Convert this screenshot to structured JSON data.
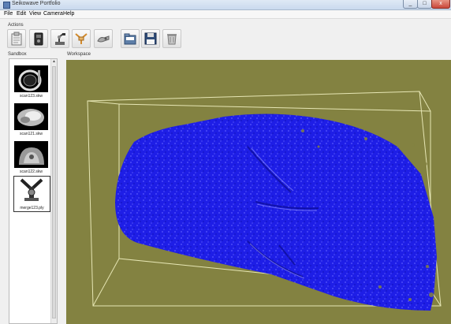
{
  "window": {
    "title": "Seikowave Portfolio",
    "btn_min": "_",
    "btn_max": "□",
    "btn_close": "x"
  },
  "menu": [
    {
      "label": "File"
    },
    {
      "label": "Edit"
    },
    {
      "label": "View"
    },
    {
      "label": "Camera"
    },
    {
      "label": "Help"
    }
  ],
  "actions": {
    "label": "Actions",
    "tools": [
      {
        "icon": "clipboard-icon"
      },
      {
        "icon": "scanner-device-icon"
      },
      {
        "icon": "robot-arm-icon"
      },
      {
        "icon": "merge-tool-icon"
      },
      {
        "icon": "hand-scan-icon"
      },
      {
        "icon": "open-folder-icon"
      },
      {
        "icon": "save-floppy-icon"
      },
      {
        "icon": "trash-icon"
      }
    ]
  },
  "sandbox": {
    "label": "Sandbox",
    "items": [
      {
        "caption": "scan123.skw",
        "thumb": "ring-scan-thumbnail"
      },
      {
        "caption": "scan121.skw",
        "thumb": "cloud-scan-thumbnail"
      },
      {
        "caption": "scan122.skw",
        "thumb": "shape-scan-thumbnail"
      },
      {
        "caption": "merge123.ply",
        "thumb": "merge-thumbnail",
        "selected": true
      }
    ],
    "scroll_up": "▲"
  },
  "workspace": {
    "label": "Workspace",
    "background": "#838241",
    "mesh_color": "#1e1ee6",
    "box_color": "#e6e6b4"
  }
}
